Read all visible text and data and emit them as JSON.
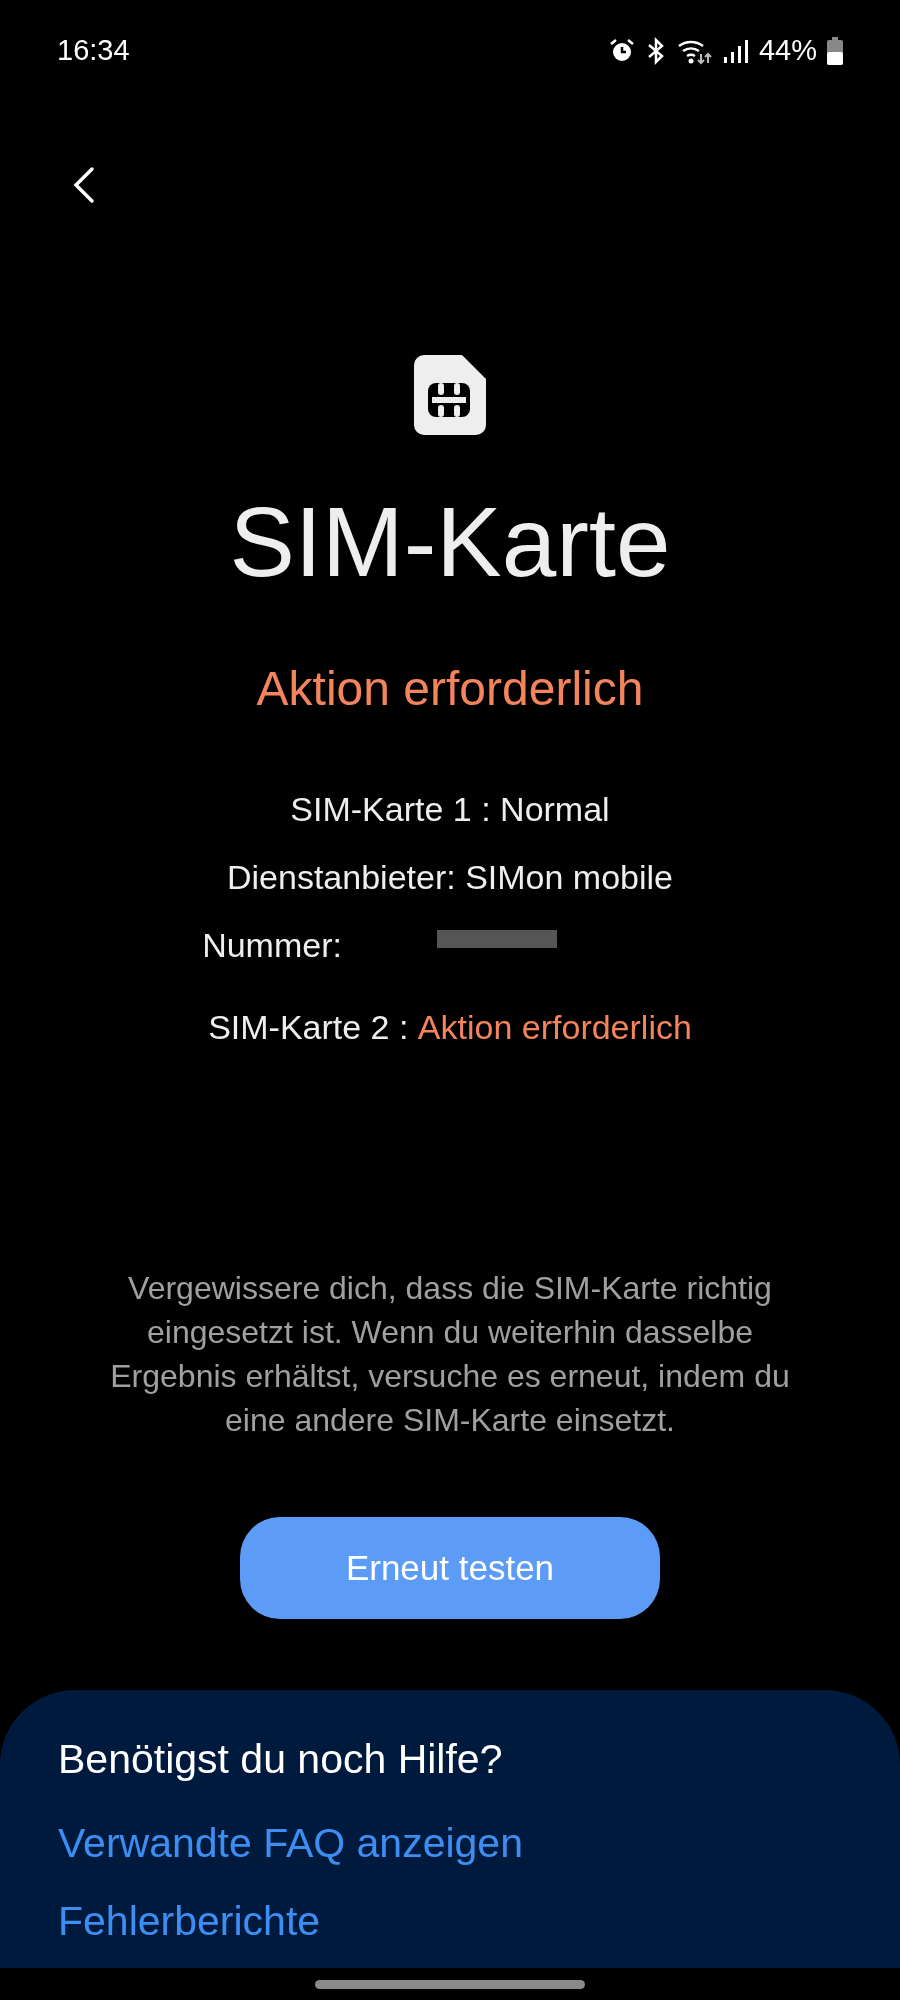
{
  "status_bar": {
    "time": "16:34",
    "battery": "44%"
  },
  "title": "SIM-Karte",
  "status": "Aktion erforderlich",
  "details": [
    {
      "kind": "plain",
      "label": "SIM-Karte 1 : ",
      "value": "Normal"
    },
    {
      "kind": "plain",
      "label": "Dienstanbieter: ",
      "value": "SIMon mobile"
    },
    {
      "kind": "redacted",
      "label": "Nummer:"
    },
    {
      "kind": "warning",
      "label": "SIM-Karte 2 : ",
      "value": "Aktion erforderlich"
    }
  ],
  "hint": "Vergewissere dich, dass die SIM-Karte richtig eingesetzt ist. Wenn du weiterhin dasselbe Ergebnis erhältst, versuche es erneut, indem du eine andere SIM-Karte einsetzt.",
  "button": "Erneut testen",
  "help": {
    "title": "Benötigst du noch Hilfe?",
    "links": [
      "Verwandte FAQ anzeigen",
      "Fehlerberichte"
    ]
  }
}
